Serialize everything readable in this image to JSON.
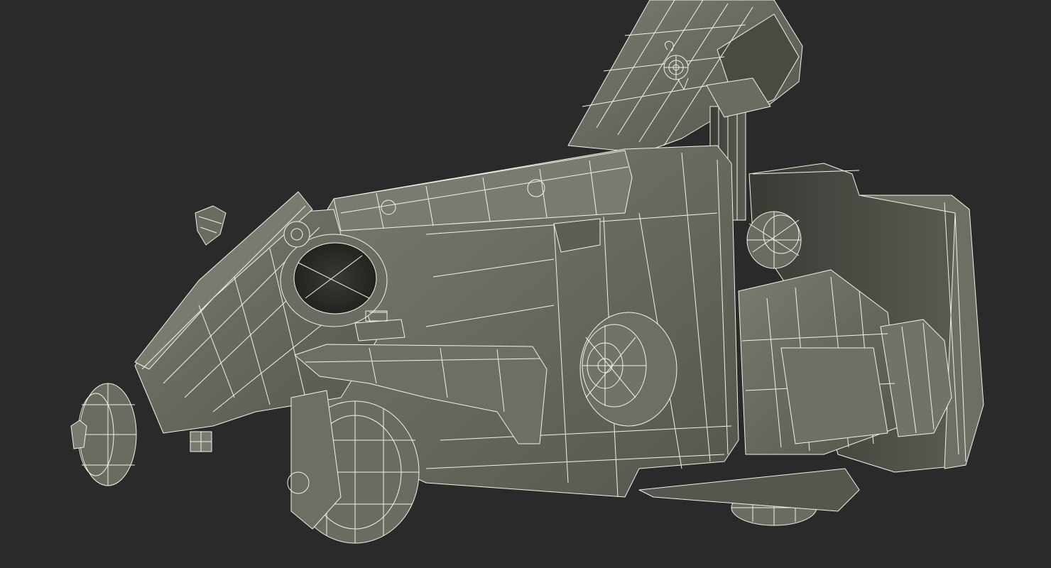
{
  "scene": {
    "subject": "wireframe-3d-render",
    "background_color": "#2a2a2a",
    "surface_color": "#6b6b61",
    "surface_shadow_color": "#3c3c36",
    "wire_color": "#f2f2e6"
  }
}
